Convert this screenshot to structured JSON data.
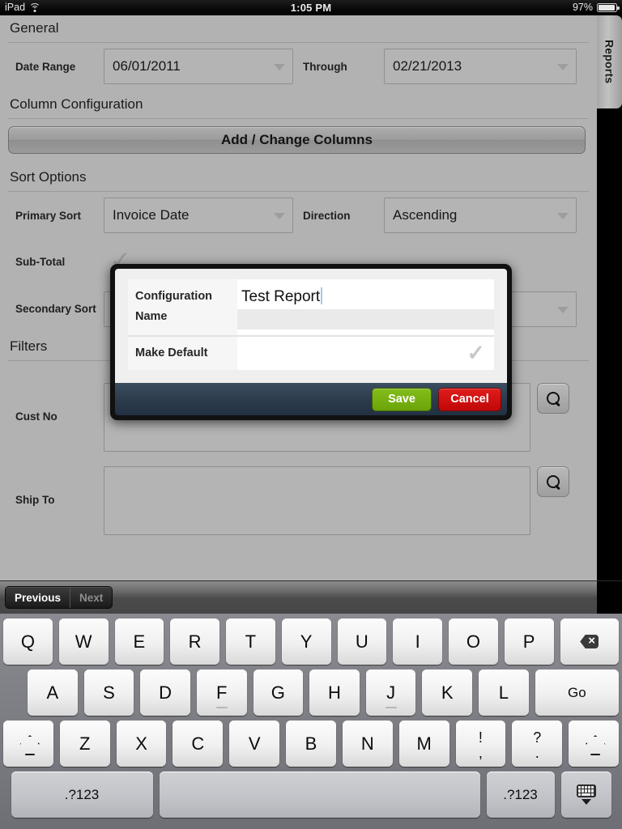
{
  "status_bar": {
    "device": "iPad",
    "wifi_icon": "wifi-icon",
    "time": "1:05 PM",
    "battery_percent": "97%",
    "battery_icon": "battery-icon"
  },
  "right_tab": {
    "label": "Reports"
  },
  "form": {
    "sections": {
      "general": "General",
      "column_configuration": "Column Configuration",
      "sort_options": "Sort Options",
      "filters": "Filters"
    },
    "date_range": {
      "label": "Date Range",
      "value": "06/01/2011",
      "through_label": "Through",
      "through_value": "02/21/2013"
    },
    "add_change_columns": "Add / Change Columns",
    "primary_sort": {
      "label": "Primary Sort",
      "value": "Invoice Date",
      "direction_label": "Direction",
      "direction_value": "Ascending"
    },
    "sub_total": {
      "label": "Sub-Total",
      "checked_glyph": "✓"
    },
    "secondary_sort": {
      "label": "Secondary Sort",
      "value": ""
    },
    "cust_no": {
      "label": "Cust No",
      "value": "",
      "search_icon": "search-icon"
    },
    "ship_to": {
      "label": "Ship To",
      "value": "",
      "search_icon": "search-icon"
    }
  },
  "modal": {
    "rows": [
      {
        "label": "Configuration Name",
        "value": "Test Report",
        "type": "text"
      },
      {
        "label": "Make Default",
        "value": "✓",
        "type": "checkbox"
      }
    ],
    "save_label": "Save",
    "cancel_label": "Cancel",
    "save_color": "#82bd1a",
    "cancel_color": "#e01c1c",
    "footer_color": "#2b3b4b"
  },
  "accessory_bar": {
    "previous_label": "Previous",
    "next_label": "Next"
  },
  "keyboard": {
    "row1": [
      "Q",
      "W",
      "E",
      "R",
      "T",
      "Y",
      "U",
      "I",
      "O",
      "P"
    ],
    "row1_backspace_icon": "backspace-icon",
    "row2": [
      "A",
      "S",
      "D",
      "F",
      "G",
      "H",
      "J",
      "K",
      "L"
    ],
    "row2_go_label": "Go",
    "row3": [
      "Z",
      "X",
      "C",
      "V",
      "B",
      "N",
      "M"
    ],
    "row3_shift_icon": "shift-icon",
    "row3_punct1": {
      "up": "!",
      "dn": ","
    },
    "row3_punct2": {
      "up": "?",
      "dn": "."
    },
    "row4_numeric_left": ".?123",
    "row4_space": "",
    "row4_numeric_right": ".?123",
    "row4_hide_icon": "hide-keyboard-icon"
  }
}
